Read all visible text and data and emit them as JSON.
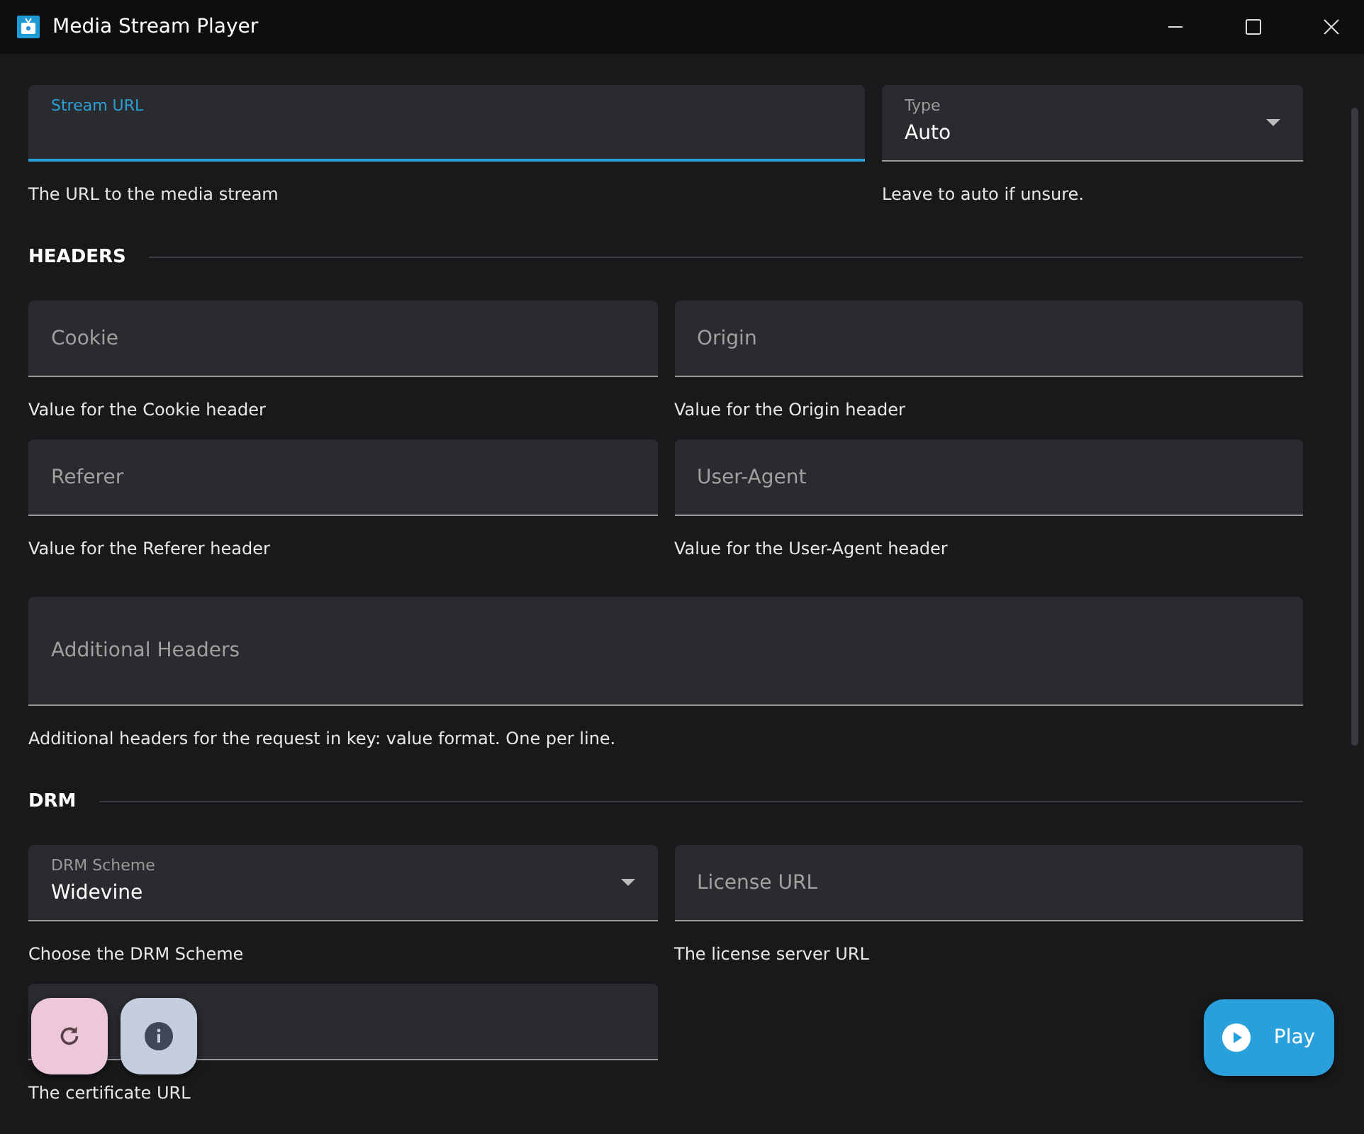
{
  "window": {
    "title": "Media Stream Player"
  },
  "rows": [
    {
      "kind": "primary-fields",
      "fields": [
        {
          "kind": "text",
          "label": "Stream URL",
          "focused": true,
          "helper": "The URL to the media stream"
        },
        {
          "kind": "select",
          "label": "Type",
          "value": "Auto",
          "focused": false,
          "helper": "Leave to auto if unsure."
        }
      ]
    },
    {
      "kind": "heading",
      "text": "HEADERS"
    },
    {
      "kind": "fields",
      "fields": [
        {
          "kind": "text",
          "placeholder": "Cookie",
          "focused": false,
          "helper": "Value for the Cookie header"
        },
        {
          "kind": "text",
          "placeholder": "Origin",
          "focused": false,
          "helper": "Value for the Origin header"
        }
      ]
    },
    {
      "kind": "fields",
      "fields": [
        {
          "kind": "text",
          "placeholder": "Referer",
          "focused": false,
          "helper": "Value for the Referer header"
        },
        {
          "kind": "text",
          "placeholder": "User-Agent",
          "focused": false,
          "helper": "Value for the User-Agent header"
        }
      ]
    },
    {
      "kind": "fields",
      "fields": [
        {
          "kind": "textarea",
          "placeholder": "Additional Headers",
          "focused": false,
          "helper": "Additional headers for the request in key: value format. One per line."
        }
      ]
    },
    {
      "kind": "heading",
      "text": "DRM"
    },
    {
      "kind": "fields",
      "fields": [
        {
          "kind": "select",
          "label": "DRM Scheme",
          "value": "Widevine",
          "focused": false,
          "helper": "Choose the DRM Scheme"
        },
        {
          "kind": "text",
          "placeholder": "License URL",
          "focused": false,
          "helper": "The license server URL"
        }
      ]
    },
    {
      "kind": "fields",
      "fields": [
        {
          "kind": "text",
          "focused": false,
          "helper": "The certificate URL"
        }
      ]
    }
  ],
  "actions": {
    "play": "Play"
  }
}
